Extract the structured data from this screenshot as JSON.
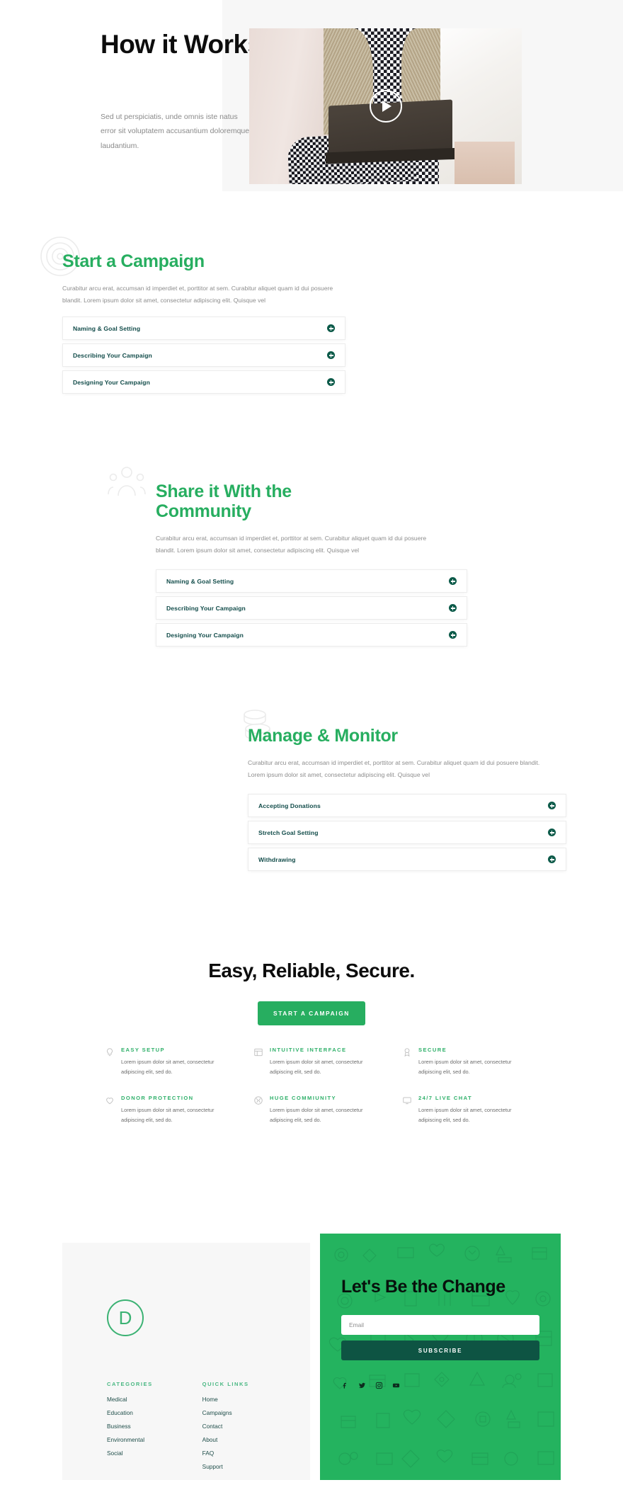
{
  "hero": {
    "title": "How it Works",
    "paragraph": "Sed ut perspiciatis, unde omnis iste natus error sit voluptatem accusantium doloremque laudantium.",
    "play_label": "play-video"
  },
  "sections": [
    {
      "id": "start",
      "heading": "Start a Campaign",
      "paragraph": "Curabitur arcu erat, accumsan id imperdiet et, porttitor at sem. Curabitur aliquet quam id dui posuere blandit. Lorem ipsum dolor sit amet, consectetur adipiscing elit. Quisque vel",
      "decoration": "target-rings-icon",
      "items": [
        "Naming & Goal Setting",
        "Describing Your Campaign",
        "Designing Your Campaign"
      ]
    },
    {
      "id": "share",
      "heading": "Share it With the Community",
      "paragraph": "Curabitur arcu erat, accumsan id imperdiet et, porttitor at sem. Curabitur aliquet quam id dui posuere blandit. Lorem ipsum dolor sit amet, consectetur adipiscing elit. Quisque vel",
      "decoration": "people-group-icon",
      "items": [
        "Naming & Goal Setting",
        "Describing Your Campaign",
        "Designing Your Campaign"
      ]
    },
    {
      "id": "manage",
      "heading": "Manage & Monitor",
      "paragraph": "Curabitur arcu erat, accumsan id imperdiet et, porttitor at sem. Curabitur aliquet quam id dui posuere blandit. Lorem ipsum dolor sit amet, consectetur adipiscing elit. Quisque vel",
      "decoration": "coins-stack-icon",
      "items": [
        "Accepting Donations",
        "Stretch Goal Setting",
        "Withdrawing"
      ]
    }
  ],
  "cta": {
    "title": "Easy, Reliable, Secure.",
    "button": "START A CAMPAIGN"
  },
  "features": [
    {
      "icon": "lightbulb-icon",
      "title": "EASY SETUP",
      "text": "Lorem ipsum dolor sit amet, consectetur adipiscing elit, sed do."
    },
    {
      "icon": "interface-icon",
      "title": "INTUITIVE INTERFACE",
      "text": "Lorem ipsum dolor sit amet, consectetur adipiscing elit, sed do."
    },
    {
      "icon": "badge-icon",
      "title": "SECURE",
      "text": "Lorem ipsum dolor sit amet, consectetur adipiscing elit, sed do."
    },
    {
      "icon": "heart-icon",
      "title": "DONOR PROTECTION",
      "text": "Lorem ipsum dolor sit amet, consectetur adipiscing elit, sed do."
    },
    {
      "icon": "globe-icon",
      "title": "HUGE COMMIUNITY",
      "text": "Lorem ipsum dolor sit amet, consectetur adipiscing elit, sed do."
    },
    {
      "icon": "monitor-icon",
      "title": "24/7 LIVE CHAT",
      "text": "Lorem ipsum dolor sit amet, consectetur adipiscing elit, sed do."
    }
  ],
  "footer": {
    "logo_letter": "D",
    "logo_icon": "circle-d-logo",
    "columns": [
      {
        "title": "CATEGORIES",
        "links": [
          "Medical",
          "Education",
          "Business",
          "Environmental",
          "Social"
        ]
      },
      {
        "title": "QUICK LINKS",
        "links": [
          "Home",
          "Campaigns",
          "Contact",
          "About",
          "FAQ",
          "Support"
        ]
      }
    ],
    "newsletter": {
      "title": "Let's Be the Change",
      "email_placeholder": "Email",
      "email_value": "",
      "subscribe": "SUBSCRIBE",
      "social": [
        "facebook-icon",
        "twitter-icon",
        "instagram-icon",
        "youtube-icon"
      ]
    }
  },
  "colors": {
    "brand_green": "#27ae60",
    "panel_green": "#24b35f",
    "dark_green": "#0e5443",
    "accordion_text": "#124c4a",
    "muted_text": "#8d8d8d",
    "panel_gray": "#f7f7f7"
  }
}
